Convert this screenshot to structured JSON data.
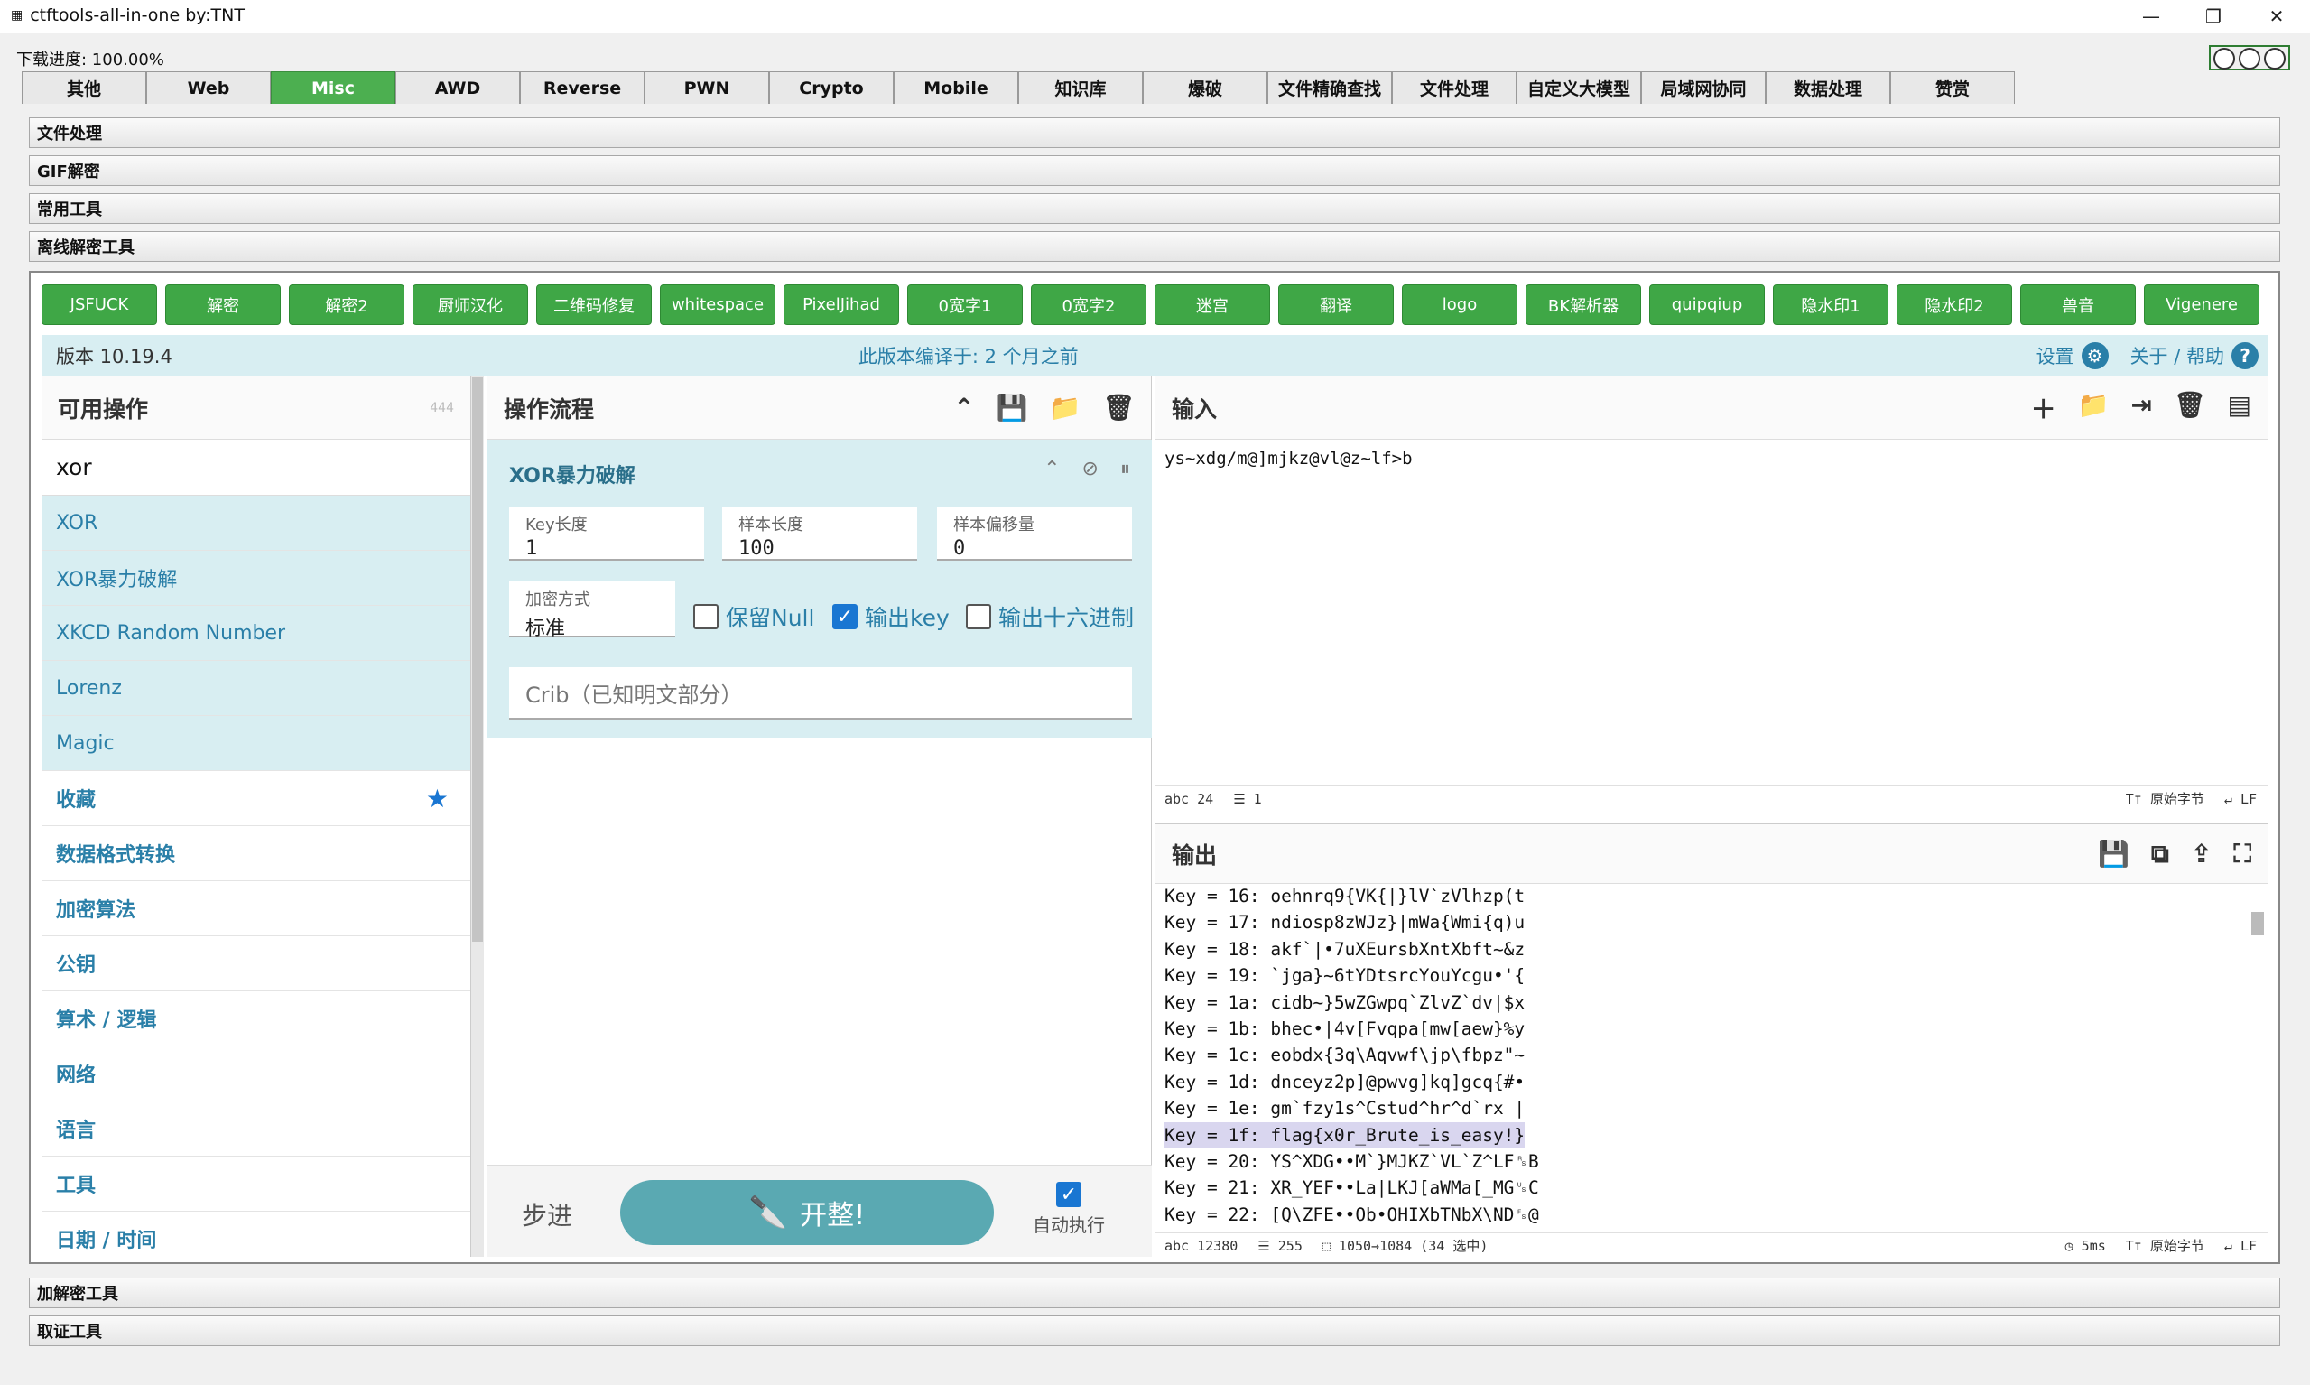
{
  "window": {
    "title": "ctftools-all-in-one   by:TNT"
  },
  "download_progress": "下载进度: 100.00%",
  "tabs": [
    "其他",
    "Web",
    "Misc",
    "AWD",
    "Reverse",
    "PWN",
    "Crypto",
    "Mobile",
    "知识库",
    "爆破",
    "文件精确查找",
    "文件处理",
    "自定义大模型",
    "局域网协同",
    "数据处理",
    "赞赏"
  ],
  "active_tab": "Misc",
  "sections_top": [
    "文件处理",
    "GIF解密",
    "常用工具",
    "离线解密工具"
  ],
  "sections_bottom": [
    "加解密工具",
    "取证工具"
  ],
  "tool_buttons": [
    "JSFUCK",
    "解密",
    "解密2",
    "厨师汉化",
    "二维码修复",
    "whitespace",
    "PixelJihad",
    "0宽字1",
    "0宽字2",
    "迷宫",
    "翻译",
    "logo",
    "BK解析器",
    "quipqiup",
    "隐水印1",
    "隐水印2",
    "兽音",
    "Vigenere"
  ],
  "version": {
    "label": "版本 10.19.4",
    "compiled": "此版本编译于:  2 个月之前",
    "settings": "设置",
    "about": "关于 / 帮助"
  },
  "operations": {
    "title": "可用操作",
    "count": "444",
    "search_value": "xor",
    "results": [
      "XOR",
      "XOR暴力破解",
      "XKCD Random Number",
      "Lorenz",
      "Magic"
    ],
    "categories": [
      "收藏",
      "数据格式转换",
      "加密算法",
      "公钥",
      "算术 / 逻辑",
      "网络",
      "语言",
      "工具",
      "日期 / 时间"
    ]
  },
  "recipe": {
    "title": "操作流程",
    "op_name": "XOR暴力破解",
    "key_length": {
      "label": "Key长度",
      "value": "1"
    },
    "sample_length": {
      "label": "样本长度",
      "value": "100"
    },
    "sample_offset": {
      "label": "样本偏移量",
      "value": "0"
    },
    "scheme": {
      "label": "加密方式",
      "value": "标准"
    },
    "null_preserving": {
      "label": "保留Null",
      "checked": false
    },
    "print_key": {
      "label": "输出key",
      "checked": true
    },
    "output_hex": {
      "label": "输出十六进制",
      "checked": false
    },
    "crib": "Crib（已知明文部分）",
    "step": "步进",
    "bake": "开整!",
    "auto": "自动执行"
  },
  "input": {
    "title": "输入",
    "text": "ys~xdg/m@]mjkz@vl@z~lf>b",
    "len": "24",
    "lines": "1",
    "encoding": "原始字节",
    "eol": "LF"
  },
  "output": {
    "title": "输出",
    "lines": [
      "Key = 16: oehnrq9{VK{|}lV`zVlhzp(t",
      "Key = 17: ndiosp8zWJz}|mWa{Wmi{q)u",
      "Key = 18: akf`|•7uXEursbXntXbft~&z",
      "Key = 19: `jga}~6tYDtsrcYouYcgu•'{",
      "Key = 1a: cidb~}5wZGwpq`ZlvZ`dv|$x",
      "Key = 1b: bhec•|4v[Fvqpa[mw[aew}%y",
      "Key = 1c: eobdx{3q\\Aqvwf\\jp\\fbpz\"~",
      "Key = 1d: dnceyz2p]@pwvg]kq]gcq{#•",
      "Key = 1e: gm`fzy1s^Cstud^hr^d`rx |",
      "Key = 1f: flag{x0r_Brute_is_easy!}",
      "Key = 20: YS^XDG••M`}MJKZ`VL`Z^LF␞B",
      "Key = 21: XR_YEF••La|LKJ[aWMa[_MG␟C",
      "Key = 22: [Q\\ZFE••Ob•OHIXbTNbX\\ND␜@"
    ],
    "highlight_index": 9,
    "len": "12380",
    "lines_count": "255",
    "selection": "1050→1084 (34 选中)",
    "time": "5ms",
    "encoding": "原始字节",
    "eol": "LF"
  }
}
